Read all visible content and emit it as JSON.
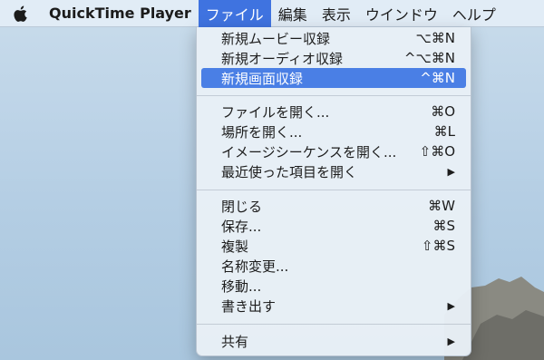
{
  "menubar": {
    "app_name": "QuickTime Player",
    "items": [
      "ファイル",
      "編集",
      "表示",
      "ウインドウ",
      "ヘルプ"
    ]
  },
  "menu": {
    "items": [
      {
        "label": "新規ムービー収録",
        "shortcut": "⌥⌘N"
      },
      {
        "label": "新規オーディオ収録",
        "shortcut": "^⌥⌘N"
      },
      {
        "label": "新規画面収録",
        "shortcut": "^⌘N"
      },
      {
        "label": "ファイルを開く...",
        "shortcut": "⌘O"
      },
      {
        "label": "場所を開く...",
        "shortcut": "⌘L"
      },
      {
        "label": "イメージシーケンスを開く...",
        "shortcut": "⇧⌘O"
      },
      {
        "label": "最近使った項目を開く",
        "shortcut": "▶"
      },
      {
        "label": "閉じる",
        "shortcut": "⌘W"
      },
      {
        "label": "保存...",
        "shortcut": "⌘S"
      },
      {
        "label": "複製",
        "shortcut": "⇧⌘S"
      },
      {
        "label": "名称変更...",
        "shortcut": ""
      },
      {
        "label": "移動...",
        "shortcut": ""
      },
      {
        "label": "書き出す",
        "shortcut": "▶"
      },
      {
        "label": "共有",
        "shortcut": "▶"
      }
    ]
  },
  "colors": {
    "highlight": "#4a7fe5",
    "menubar_active": "#3f73e0"
  },
  "icons": {
    "apple": "apple-logo-icon",
    "submenu": "chevron-right-icon"
  }
}
